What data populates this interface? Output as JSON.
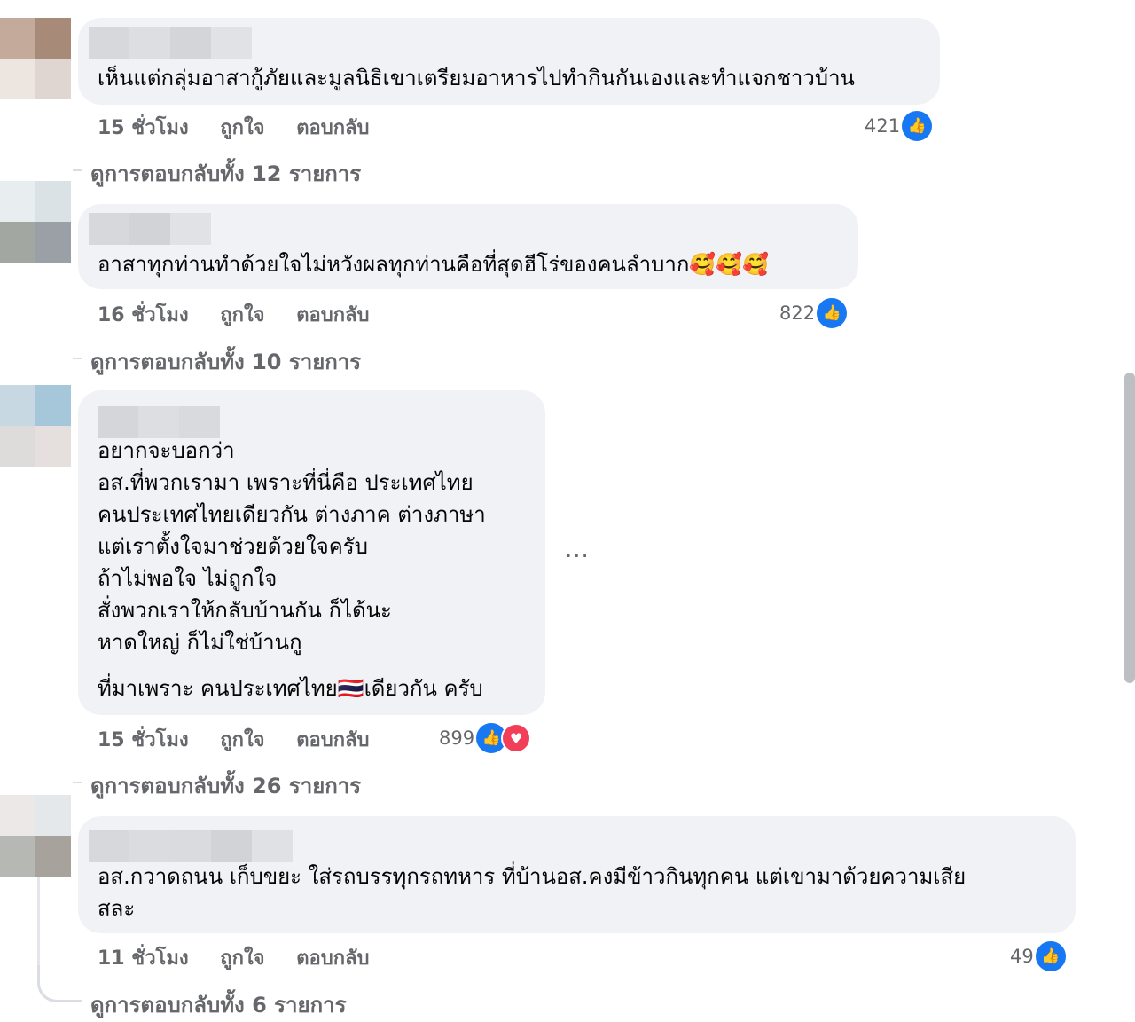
{
  "comments": [
    {
      "text": "เห็นแต่กลุ่มอาสากู้ภัยและมูลนิธิเขาเตรียมอาหารไปทำกินกันเองและทำแจกชาวบ้าน",
      "time": "15 ชั่วโมง",
      "like": "ถูกใจ",
      "reply": "ตอบกลับ",
      "count": "421",
      "replies": "ดูการตอบกลับทั้ง 12 รายการ"
    },
    {
      "text": "อาสาทุกท่านทำด้วยใจไม่หวังผลทุกท่านคือที่สุดฮีโร่ของคนลำบาก🥰🥰🥰",
      "time": "16 ชั่วโมง",
      "like": "ถูกใจ",
      "reply": "ตอบกลับ",
      "count": "822",
      "replies": "ดูการตอบกลับทั้ง 10 รายการ"
    },
    {
      "text": "อยากจะบอกว่า\nอส.ที่พวกเรามา เพราะที่นี่คือ ประเทศไทย\nคนประเทศไทยเดียวกัน ต่างภาค ต่างภาษา\nแต่เราตั้งใจมาช่วยด้วยใจครับ\nถ้าไม่พอใจ ไม่ถูกใจ\nสั่งพวกเราให้กลับบ้านกัน ก็ได้นะ\nหาดใหญ่ ก็ไม่ใช่บ้านกู",
      "text2": "ที่มาเพราะ คนประเทศไทย🇹🇭เดียวกัน ครับ",
      "time": "15 ชั่วโมง",
      "like": "ถูกใจ",
      "reply": "ตอบกลับ",
      "count": "899",
      "replies": "ดูการตอบกลับทั้ง 26 รายการ",
      "more": "..."
    },
    {
      "text": "อส.กวาดถนน เก็บขยะ ใส่รถบรรทุกรถทหาร ที่บ้านอส.คงมีข้าวกินทุกคน แต่เขามาด้วยความเสีย\nสละ",
      "time": "11 ชั่วโมง",
      "like": "ถูกใจ",
      "reply": "ตอบกลับ",
      "count": "49",
      "replies": "ดูการตอบกลับทั้ง 6 รายการ"
    }
  ],
  "icons": {
    "like": "like-icon",
    "love": "love-icon"
  },
  "colors": {
    "like": "#1877f2",
    "love": "#f33e58",
    "meta": "#65676b",
    "bubble": "#f0f2f5"
  }
}
